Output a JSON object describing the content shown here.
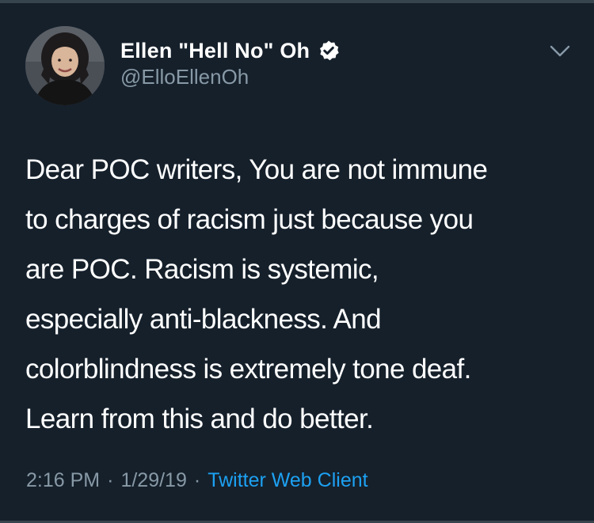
{
  "author": {
    "display_name": "Ellen \"Hell No\" Oh",
    "handle": "@ElloEllenOh",
    "verified": true
  },
  "tweet": {
    "lines": [
      "Dear POC writers, You are not immune",
      "to charges of racism just because you",
      "are POC. Racism is systemic,",
      "especially anti-blackness. And",
      "colorblindness is extremely tone deaf.",
      "Learn from this and do better."
    ]
  },
  "meta": {
    "time": "2:16 PM",
    "separator": "·",
    "date": "1/29/19",
    "client": "Twitter Web Client"
  },
  "icons": {
    "verified": "verified-badge-icon",
    "menu": "chevron-down-icon"
  },
  "colors": {
    "background": "#15202b",
    "text_primary": "#ffffff",
    "text_secondary": "#8899a6",
    "link": "#1da1f2",
    "divider": "#38444d"
  }
}
